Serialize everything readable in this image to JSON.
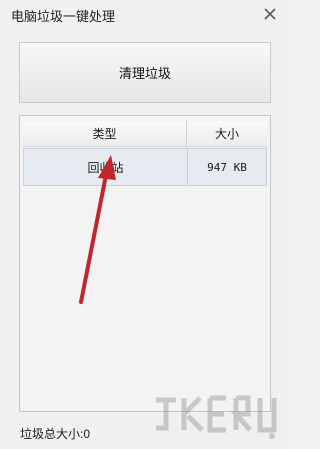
{
  "window": {
    "title": "电脑垃圾一键处理"
  },
  "actions": {
    "clean_label": "清理垃圾"
  },
  "table": {
    "headers": [
      "类型",
      "大小"
    ],
    "rows": [
      {
        "type": "回收站",
        "size": "947 KB"
      }
    ]
  },
  "status": {
    "text": "垃圾总大小:0"
  },
  "icons": {
    "close": "close-icon",
    "arrow": "red-arrow-annotation",
    "watermark": "watermark-logo"
  },
  "colors": {
    "arrow": "#c0262b",
    "row_selected": "#e6ebf1"
  }
}
